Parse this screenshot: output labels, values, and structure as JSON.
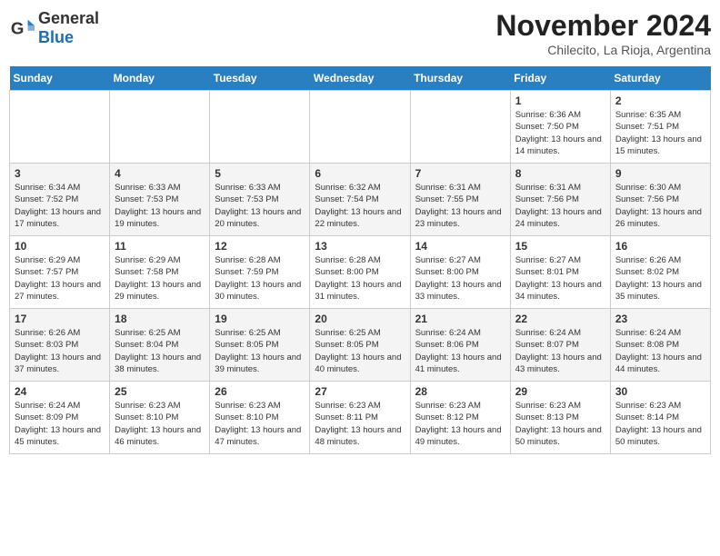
{
  "header": {
    "logo_general": "General",
    "logo_blue": "Blue",
    "month_title": "November 2024",
    "location": "Chilecito, La Rioja, Argentina"
  },
  "weekdays": [
    "Sunday",
    "Monday",
    "Tuesday",
    "Wednesday",
    "Thursday",
    "Friday",
    "Saturday"
  ],
  "weeks": [
    [
      {
        "day": "",
        "content": ""
      },
      {
        "day": "",
        "content": ""
      },
      {
        "day": "",
        "content": ""
      },
      {
        "day": "",
        "content": ""
      },
      {
        "day": "",
        "content": ""
      },
      {
        "day": "1",
        "content": "Sunrise: 6:36 AM\nSunset: 7:50 PM\nDaylight: 13 hours and 14 minutes."
      },
      {
        "day": "2",
        "content": "Sunrise: 6:35 AM\nSunset: 7:51 PM\nDaylight: 13 hours and 15 minutes."
      }
    ],
    [
      {
        "day": "3",
        "content": "Sunrise: 6:34 AM\nSunset: 7:52 PM\nDaylight: 13 hours and 17 minutes."
      },
      {
        "day": "4",
        "content": "Sunrise: 6:33 AM\nSunset: 7:53 PM\nDaylight: 13 hours and 19 minutes."
      },
      {
        "day": "5",
        "content": "Sunrise: 6:33 AM\nSunset: 7:53 PM\nDaylight: 13 hours and 20 minutes."
      },
      {
        "day": "6",
        "content": "Sunrise: 6:32 AM\nSunset: 7:54 PM\nDaylight: 13 hours and 22 minutes."
      },
      {
        "day": "7",
        "content": "Sunrise: 6:31 AM\nSunset: 7:55 PM\nDaylight: 13 hours and 23 minutes."
      },
      {
        "day": "8",
        "content": "Sunrise: 6:31 AM\nSunset: 7:56 PM\nDaylight: 13 hours and 24 minutes."
      },
      {
        "day": "9",
        "content": "Sunrise: 6:30 AM\nSunset: 7:56 PM\nDaylight: 13 hours and 26 minutes."
      }
    ],
    [
      {
        "day": "10",
        "content": "Sunrise: 6:29 AM\nSunset: 7:57 PM\nDaylight: 13 hours and 27 minutes."
      },
      {
        "day": "11",
        "content": "Sunrise: 6:29 AM\nSunset: 7:58 PM\nDaylight: 13 hours and 29 minutes."
      },
      {
        "day": "12",
        "content": "Sunrise: 6:28 AM\nSunset: 7:59 PM\nDaylight: 13 hours and 30 minutes."
      },
      {
        "day": "13",
        "content": "Sunrise: 6:28 AM\nSunset: 8:00 PM\nDaylight: 13 hours and 31 minutes."
      },
      {
        "day": "14",
        "content": "Sunrise: 6:27 AM\nSunset: 8:00 PM\nDaylight: 13 hours and 33 minutes."
      },
      {
        "day": "15",
        "content": "Sunrise: 6:27 AM\nSunset: 8:01 PM\nDaylight: 13 hours and 34 minutes."
      },
      {
        "day": "16",
        "content": "Sunrise: 6:26 AM\nSunset: 8:02 PM\nDaylight: 13 hours and 35 minutes."
      }
    ],
    [
      {
        "day": "17",
        "content": "Sunrise: 6:26 AM\nSunset: 8:03 PM\nDaylight: 13 hours and 37 minutes."
      },
      {
        "day": "18",
        "content": "Sunrise: 6:25 AM\nSunset: 8:04 PM\nDaylight: 13 hours and 38 minutes."
      },
      {
        "day": "19",
        "content": "Sunrise: 6:25 AM\nSunset: 8:05 PM\nDaylight: 13 hours and 39 minutes."
      },
      {
        "day": "20",
        "content": "Sunrise: 6:25 AM\nSunset: 8:05 PM\nDaylight: 13 hours and 40 minutes."
      },
      {
        "day": "21",
        "content": "Sunrise: 6:24 AM\nSunset: 8:06 PM\nDaylight: 13 hours and 41 minutes."
      },
      {
        "day": "22",
        "content": "Sunrise: 6:24 AM\nSunset: 8:07 PM\nDaylight: 13 hours and 43 minutes."
      },
      {
        "day": "23",
        "content": "Sunrise: 6:24 AM\nSunset: 8:08 PM\nDaylight: 13 hours and 44 minutes."
      }
    ],
    [
      {
        "day": "24",
        "content": "Sunrise: 6:24 AM\nSunset: 8:09 PM\nDaylight: 13 hours and 45 minutes."
      },
      {
        "day": "25",
        "content": "Sunrise: 6:23 AM\nSunset: 8:10 PM\nDaylight: 13 hours and 46 minutes."
      },
      {
        "day": "26",
        "content": "Sunrise: 6:23 AM\nSunset: 8:10 PM\nDaylight: 13 hours and 47 minutes."
      },
      {
        "day": "27",
        "content": "Sunrise: 6:23 AM\nSunset: 8:11 PM\nDaylight: 13 hours and 48 minutes."
      },
      {
        "day": "28",
        "content": "Sunrise: 6:23 AM\nSunset: 8:12 PM\nDaylight: 13 hours and 49 minutes."
      },
      {
        "day": "29",
        "content": "Sunrise: 6:23 AM\nSunset: 8:13 PM\nDaylight: 13 hours and 50 minutes."
      },
      {
        "day": "30",
        "content": "Sunrise: 6:23 AM\nSunset: 8:14 PM\nDaylight: 13 hours and 50 minutes."
      }
    ]
  ]
}
